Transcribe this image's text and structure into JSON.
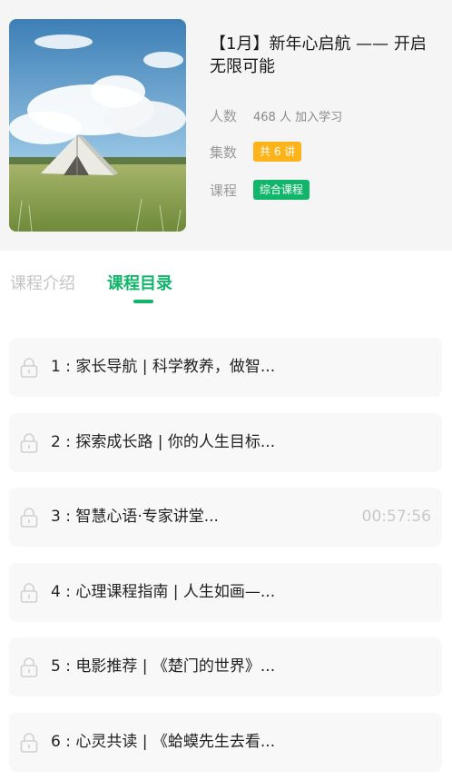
{
  "course": {
    "title": "【1月】新年心启航 —— 开启无限可能",
    "cover_icon": "tent-in-meadow-image",
    "meta": {
      "count_label": "人数",
      "count_value": "468 人 加入学习",
      "episodes_label": "集数",
      "episodes_value": "共 6 讲",
      "category_label": "课程",
      "category_value": "综合课程"
    }
  },
  "tabs": [
    {
      "label": "课程介绍",
      "active": false
    },
    {
      "label": "课程目录",
      "active": true
    }
  ],
  "lessons": [
    {
      "title": "1 : 家长导航 | 科学教养，做智...",
      "duration": "",
      "icon": "lock-icon"
    },
    {
      "title": "2 : 探索成长路 | 你的人生目标...",
      "duration": "",
      "icon": "lock-icon"
    },
    {
      "title": "3 : 智慧心语·专家讲堂...",
      "duration": "00:57:56",
      "icon": "lock-icon"
    },
    {
      "title": "4 : 心理课程指南 | 人生如画—...",
      "duration": "",
      "icon": "lock-icon"
    },
    {
      "title": "5 : 电影推荐 | 《楚门的世界》...",
      "duration": "",
      "icon": "lock-icon"
    },
    {
      "title": "6 : 心灵共读 | 《蛤蟆先生去看...",
      "duration": "",
      "icon": "lock-icon"
    }
  ],
  "colors": {
    "accent_green": "#12b66b",
    "badge_orange": "#ffb31a",
    "muted_text": "#9a9a9a"
  }
}
